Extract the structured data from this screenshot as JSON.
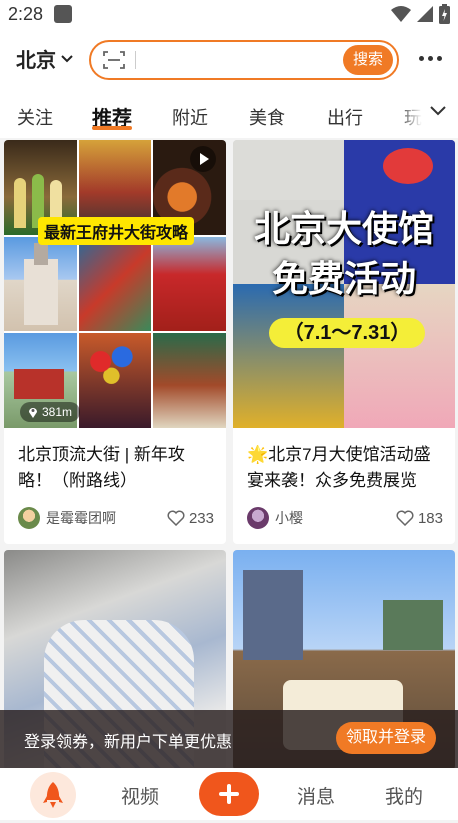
{
  "status_bar": {
    "time": "2:28"
  },
  "header": {
    "city": "北京",
    "search_button": "搜索",
    "search_placeholder": ""
  },
  "tabs": [
    {
      "label": "关注",
      "active": false
    },
    {
      "label": "推荐",
      "active": true
    },
    {
      "label": "附近",
      "active": false
    },
    {
      "label": "美食",
      "active": false
    },
    {
      "label": "出行",
      "active": false
    },
    {
      "label": "玩",
      "active": false
    }
  ],
  "feed": [
    {
      "overlay_title": "最新王府井大街攻略",
      "distance": "381m",
      "title": "北京顶流大街 | 新年攻略！（附路线）",
      "author": "是霉霉团啊",
      "likes": "233"
    },
    {
      "poster_line1": "北京大使馆",
      "poster_line2": "免费活动",
      "poster_date": "（7.1～7.31）",
      "title": "🌟北京7月大使馆活动盛宴来袭！众多免费展览",
      "author": "小樱",
      "likes": "183"
    },
    {
      "title": ""
    },
    {
      "title": ""
    }
  ],
  "promo": {
    "text": "登录领券，新用户下单更优惠",
    "button": "领取并登录"
  },
  "bottom_nav": {
    "video": "视频",
    "messages": "消息",
    "me": "我的"
  },
  "colors": {
    "accent": "#f07a25",
    "add_button": "#f0561c"
  }
}
